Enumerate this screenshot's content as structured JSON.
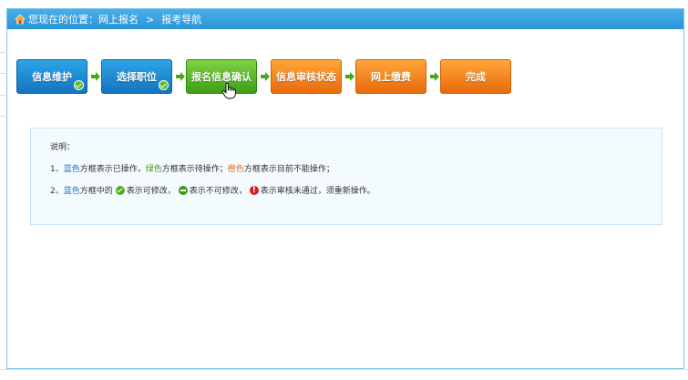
{
  "breadcrumb": {
    "prefix": "您现在的位置：",
    "level1": "网上报名",
    "separator": ">",
    "level2": "报考导航"
  },
  "steps": [
    {
      "label": "信息维护",
      "state": "done",
      "color": "#1b86d2",
      "icon": "check-icon"
    },
    {
      "label": "选择职位",
      "state": "done",
      "color": "#1b86d2",
      "icon": "check-icon"
    },
    {
      "label": "报名信息确认",
      "state": "pending",
      "color": "#56b51f"
    },
    {
      "label": "信息审核状态",
      "state": "locked",
      "color": "#f08a1e"
    },
    {
      "label": "网上缴费",
      "state": "locked",
      "color": "#f08a1e"
    },
    {
      "label": "完成",
      "state": "locked",
      "color": "#f08a1e"
    }
  ],
  "note": {
    "title": "说明：",
    "line1": {
      "num": "1、",
      "blue": "蓝色",
      "t1": "方框表示已操作，",
      "green": "绿色",
      "t2": "方框表示待操作；",
      "orange": "橙色",
      "t3": "方框表示目前不能操作；"
    },
    "line2": {
      "num": "2、",
      "blue": "蓝色",
      "t1": "方框中的",
      "t2": "表示可修改，",
      "t3": "表示不可修改，",
      "t4": "表示审核未通过，须重新操作。"
    }
  }
}
